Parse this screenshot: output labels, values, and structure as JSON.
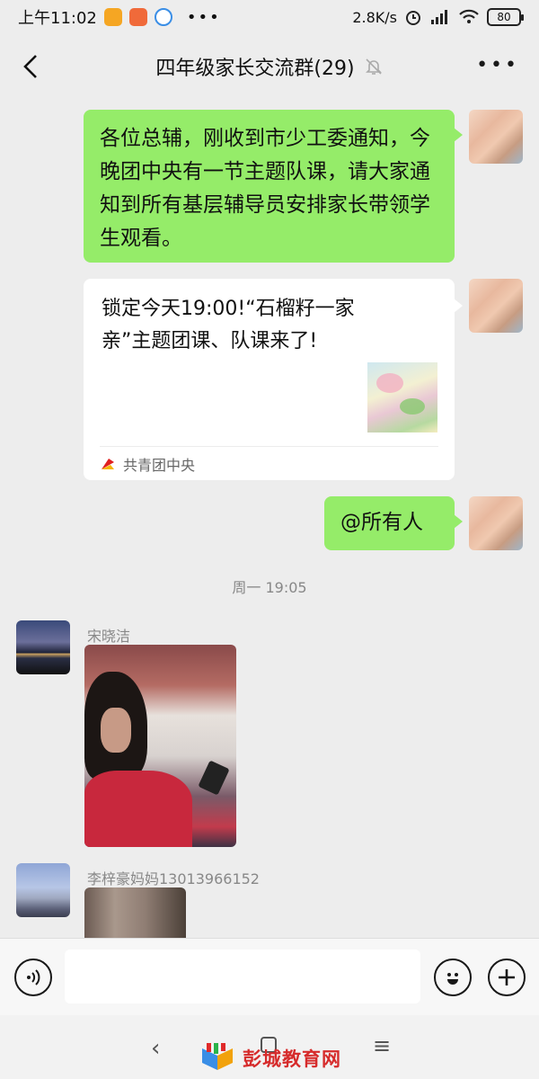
{
  "status_bar": {
    "time": "上午11:02",
    "net_speed": "2.8K/s",
    "battery": "80"
  },
  "header": {
    "title": "四年级家长交流群(29)",
    "icons": [
      "back-arrow-icon",
      "bell-muted-icon",
      "more-icon"
    ]
  },
  "messages": [
    {
      "type": "text",
      "direction": "outgoing",
      "text": "各位总辅，刚收到市少工委通知，今晚团中央有一节主题队课，请大家通知到所有基层辅导员安排家长带领学生观看。"
    },
    {
      "type": "link_card",
      "direction": "outgoing",
      "title": "锁定今天19:00!“石榴籽一家亲”主题团课、队课来了!",
      "source": "共青团中央"
    },
    {
      "type": "text",
      "direction": "outgoing",
      "text": "@所有人"
    }
  ],
  "timestamp": "周一 19:05",
  "incoming": [
    {
      "sender": "宋晓洁",
      "type": "image"
    },
    {
      "sender": "李梓豪妈妈13013966152",
      "type": "image"
    }
  ],
  "input_bar": {
    "placeholder": "",
    "icons": [
      "voice-icon",
      "emoji-icon",
      "plus-icon"
    ]
  },
  "watermark": {
    "text": "彭城教育网"
  }
}
